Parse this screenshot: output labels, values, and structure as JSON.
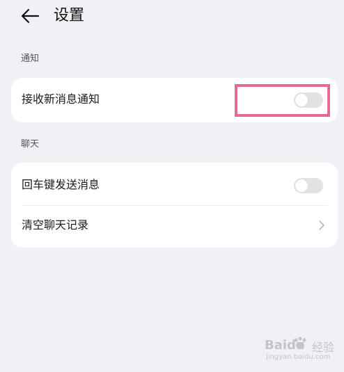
{
  "header": {
    "title": "设置",
    "back_icon": "arrow-left-icon"
  },
  "sections": [
    {
      "label": "通知",
      "items": [
        {
          "label": "接收新消息通知",
          "control": "toggle",
          "on": false,
          "highlighted": true
        }
      ]
    },
    {
      "label": "聊天",
      "items": [
        {
          "label": "回车键发送消息",
          "control": "toggle",
          "on": false
        },
        {
          "label": "清空聊天记录",
          "control": "chevron",
          "icon": "chevron-right-icon"
        }
      ]
    }
  ],
  "watermark": {
    "logo_text": "Baidu",
    "sub_text": "经验",
    "url": "jingyan.baidu.com"
  },
  "colors": {
    "background": "#f1f1f5",
    "card": "#ffffff",
    "toggle_off": "#e2e2e4",
    "highlight_border": "#e86a92"
  }
}
